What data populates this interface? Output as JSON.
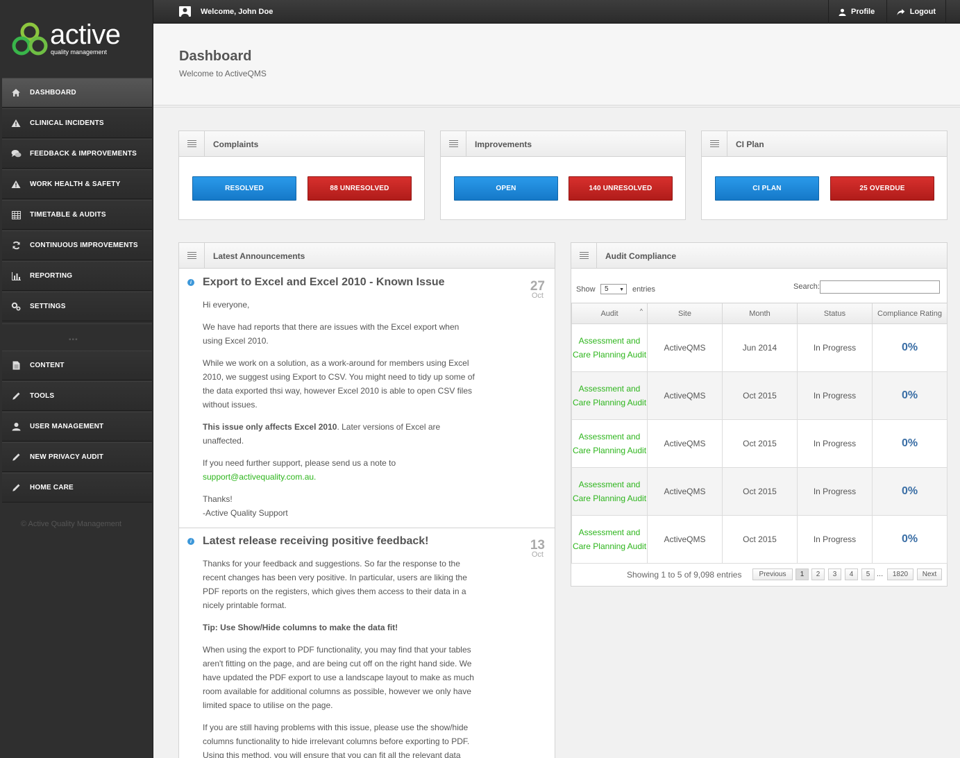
{
  "brand": {
    "name": "active",
    "tagline": "quality management"
  },
  "sidebar": {
    "items": [
      {
        "label": "DASHBOARD",
        "icon": "home-icon"
      },
      {
        "label": "CLINICAL INCIDENTS",
        "icon": "warning-icon"
      },
      {
        "label": "FEEDBACK & IMPROVEMENTS",
        "icon": "chat-icon"
      },
      {
        "label": "WORK HEALTH & SAFETY",
        "icon": "warning-icon"
      },
      {
        "label": "TIMETABLE & AUDITS",
        "icon": "calendar-icon"
      },
      {
        "label": "CONTINUOUS IMPROVEMENTS",
        "icon": "refresh-icon"
      },
      {
        "label": "REPORTING",
        "icon": "bar-chart-icon"
      },
      {
        "label": "SETTINGS",
        "icon": "cogs-icon"
      }
    ],
    "items2": [
      {
        "label": "CONTENT",
        "icon": "document-icon"
      },
      {
        "label": "TOOLS",
        "icon": "pencil-icon"
      },
      {
        "label": "USER MANAGEMENT",
        "icon": "user-icon"
      },
      {
        "label": "NEW PRIVACY AUDIT",
        "icon": "pencil-icon"
      },
      {
        "label": "HOME CARE",
        "icon": "pencil-icon"
      }
    ],
    "copyright": "© Active Quality Management"
  },
  "topbar": {
    "welcome": "Welcome, John Doe",
    "profile": "Profile",
    "logout": "Logout"
  },
  "header": {
    "title": "Dashboard",
    "subtitle": "Welcome to ActiveQMS"
  },
  "widgets": {
    "complaints": {
      "title": "Complaints",
      "btn1": "RESOLVED",
      "btn2": "88 UNRESOLVED"
    },
    "improvements": {
      "title": "Improvements",
      "btn1": "OPEN",
      "btn2": "140 UNRESOLVED"
    },
    "ciplan": {
      "title": "CI Plan",
      "btn1": "CI PLAN",
      "btn2": "25 OVERDUE"
    }
  },
  "announcements": {
    "title": "Latest Announcements",
    "a1": {
      "title": "Export to Excel and Excel 2010 - Known Issue",
      "day": "27",
      "month": "Oct",
      "p1": "Hi everyone,",
      "p2": "We have had reports that there are issues with the Excel export when using Excel 2010.",
      "p3": "While we work on a solution, as a work-around for members using Excel 2010, we suggest using Export to CSV. You might need to tidy up some of the data exported thsi way, however Excel 2010 is able to open CSV files without issues.",
      "p4_bold": "This issue only affects Excel 2010",
      "p4_rest": ". Later versions of Excel are unaffected.",
      "p5": "If you need further support, please send us a note to",
      "email": "support@activequality.com.au.",
      "p6a": "Thanks!",
      "p6b": "-Active Quality Support"
    },
    "a2": {
      "title": "Latest release receiving positive feedback!",
      "day": "13",
      "month": "Oct",
      "p1": "Thanks for your feedback and suggestions. So far the response to the recent changes has been very positive. In particular, users are liking the PDF reports on the registers, which gives them access to their data in a nicely printable format.",
      "p2": "Tip: Use Show/Hide columns to make the data fit!",
      "p3": "When using the export to PDF functionality, you may find that your tables aren't fitting on the page, and are being cut off on the right hand side. We have updated the PDF export to use a landscape layout to make as much room available for additional columns as possible, however we only have limited space to utilise on the page.",
      "p4": "If you are still having problems with this issue, please use the show/hide columns functionality to hide irrelevant columns before exporting to PDF. Using this method, you will ensure that you can fit all the relevant data"
    }
  },
  "audit": {
    "title": "Audit Compliance",
    "show": "Show",
    "show_value": "5",
    "entries": "entries",
    "search": "Search:",
    "columns": [
      "Audit",
      "Site",
      "Month",
      "Status",
      "Compliance Rating"
    ],
    "rows": [
      {
        "audit": "Assessment and Care Planning Audit",
        "site": "ActiveQMS",
        "month": "Jun 2014",
        "status": "In Progress",
        "rating": "0%"
      },
      {
        "audit": "Assessment and Care Planning Audit",
        "site": "ActiveQMS",
        "month": "Oct 2015",
        "status": "In Progress",
        "rating": "0%"
      },
      {
        "audit": "Assessment and Care Planning Audit",
        "site": "ActiveQMS",
        "month": "Oct 2015",
        "status": "In Progress",
        "rating": "0%"
      },
      {
        "audit": "Assessment and Care Planning Audit",
        "site": "ActiveQMS",
        "month": "Oct 2015",
        "status": "In Progress",
        "rating": "0%"
      },
      {
        "audit": "Assessment and Care Planning Audit",
        "site": "ActiveQMS",
        "month": "Oct 2015",
        "status": "In Progress",
        "rating": "0%"
      }
    ],
    "info": "Showing 1 to 5 of 9,098 entries",
    "pagination": {
      "previous": "Previous",
      "p1": "1",
      "p2": "2",
      "p3": "3",
      "p4": "4",
      "p5": "5",
      "ellipsis": "...",
      "last": "1820",
      "next": "Next"
    }
  }
}
